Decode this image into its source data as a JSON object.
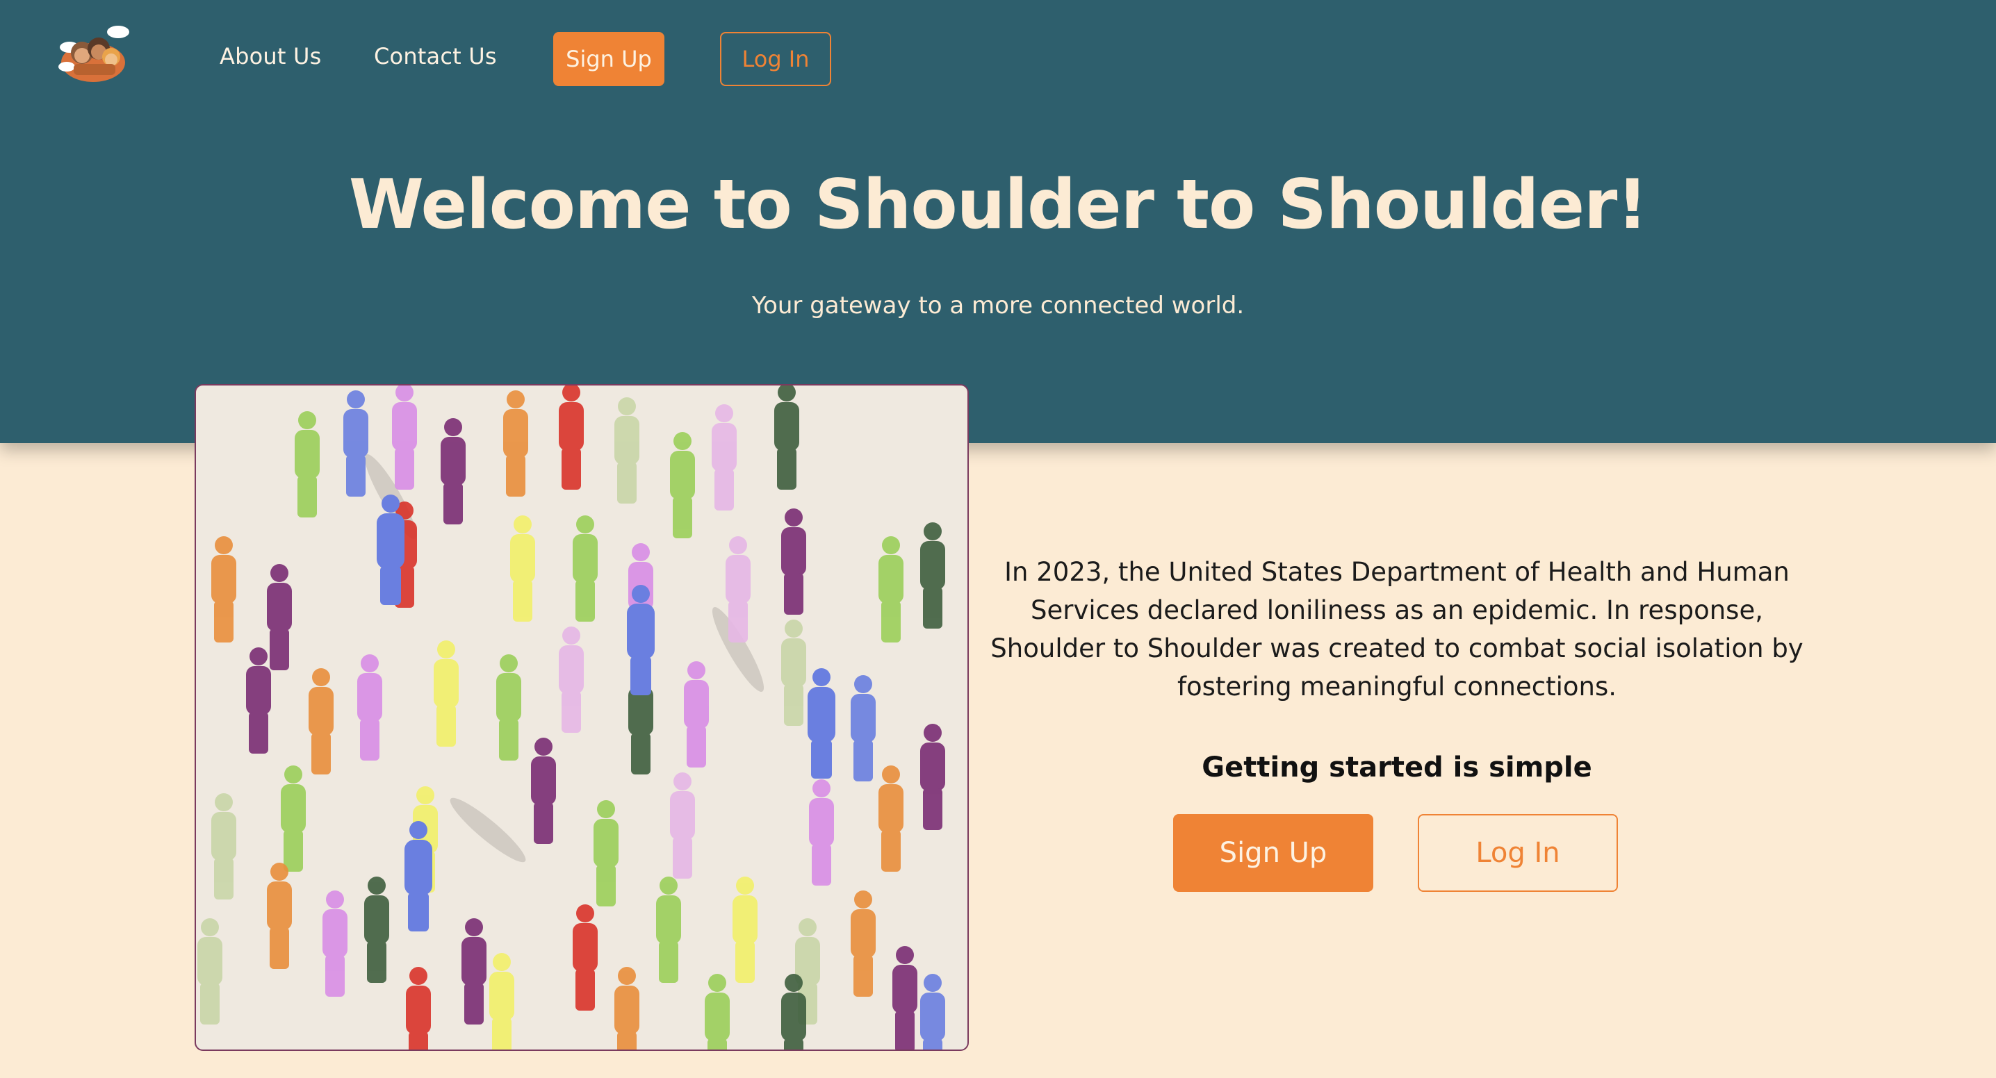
{
  "nav": {
    "logo_icon": "shoulder-to-shoulder-logo",
    "links": [
      "About Us",
      "Contact Us"
    ],
    "signup_label": "Sign Up",
    "login_label": "Log In"
  },
  "hero": {
    "title": "Welcome to Shoulder to Shoulder!",
    "subtitle": "Your gateway to a more connected world."
  },
  "main": {
    "illustration": "crowd-of-colorful-people-illustration",
    "intro_text": "In 2023, the United States Department of Health and Human Services declared loniliness as an epidemic. In response, Shoulder to Shoulder was created to combat social isolation by fostering meaningful connections.",
    "getting_started": "Getting started is simple",
    "signup_label": "Sign Up",
    "login_label": "Log In"
  },
  "colors": {
    "header_bg": "#2e5f6d",
    "page_bg": "#fcebd4",
    "accent": "#ef8335",
    "hero_text": "#fcebd4"
  }
}
